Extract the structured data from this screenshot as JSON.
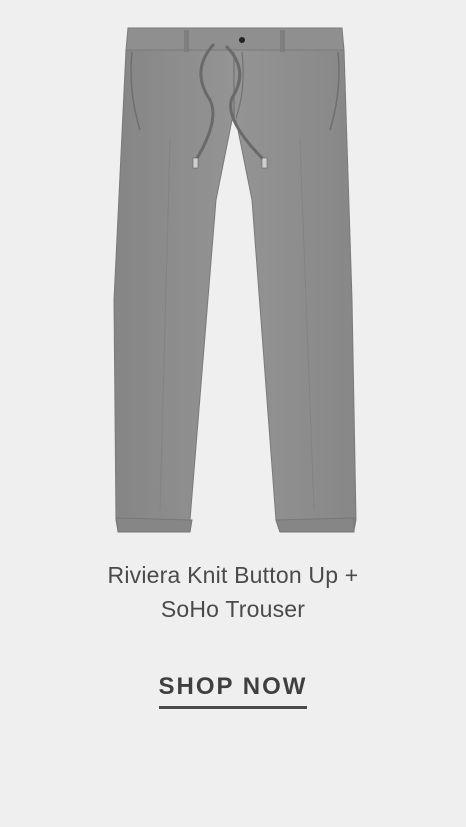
{
  "product": {
    "title_line1": "Riviera Knit Button Up +",
    "title_line2": "SoHo Trouser",
    "image_subject": "grey drawstring trousers",
    "image_color": "#8d8d8d"
  },
  "cta": {
    "label": "SHOP NOW"
  },
  "colors": {
    "background": "#efefef",
    "text": "#4a4a4a"
  }
}
